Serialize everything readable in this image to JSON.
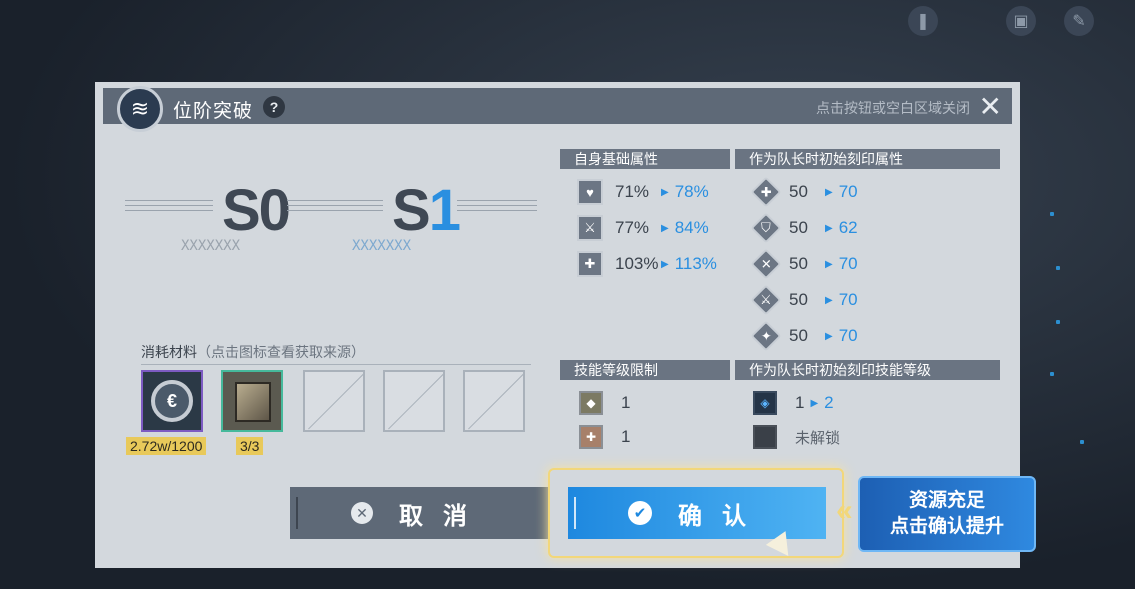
{
  "modal": {
    "title": "位阶突破",
    "help_label": "?",
    "close_hint": "点击按钮或空白区域关闭",
    "close_label": "✕"
  },
  "rank": {
    "from": "S0",
    "to_prefix": "S",
    "to_digit": "1",
    "from_chain": "XXXXXXX",
    "to_chain": "XXXXXXX"
  },
  "materials": {
    "label": "消耗材料",
    "sub_label": "（点击图标查看获取来源）",
    "items": [
      {
        "name": "gear-coin",
        "glyph": "€",
        "count": "2.72w/1200"
      },
      {
        "name": "material-cube",
        "count": "3/3"
      }
    ]
  },
  "base_stats": {
    "title": "自身基础属性",
    "rows": [
      {
        "icon": "heart-icon",
        "glyph": "♥",
        "old": "71%",
        "new": "78%"
      },
      {
        "icon": "sword-icon",
        "glyph": "⚔",
        "old": "77%",
        "new": "84%"
      },
      {
        "icon": "cross-icon",
        "glyph": "✚",
        "old": "103%",
        "new": "113%"
      }
    ]
  },
  "leader_stats": {
    "title": "作为队长时初始刻印属性",
    "rows": [
      {
        "icon": "health-cross-icon",
        "glyph": "✚",
        "old": "50",
        "new": "70"
      },
      {
        "icon": "shield-icon",
        "glyph": "⛉",
        "old": "50",
        "new": "62"
      },
      {
        "icon": "blade-icon",
        "glyph": "✕",
        "old": "50",
        "new": "70"
      },
      {
        "icon": "crossed-swords-icon",
        "glyph": "⚔",
        "old": "50",
        "new": "70"
      },
      {
        "icon": "burst-icon",
        "glyph": "✦",
        "old": "50",
        "new": "70"
      }
    ]
  },
  "skill_limit": {
    "title": "技能等级限制",
    "rows": [
      {
        "icon": "skill-portrait-icon",
        "glyph": "◆",
        "value": "1"
      },
      {
        "icon": "skill-plus-icon",
        "glyph": "✚",
        "value": "1"
      }
    ]
  },
  "leader_skill": {
    "title": "作为队长时初始刻印技能等级",
    "rows": [
      {
        "icon": "imprint-skill-icon",
        "glyph": "◈",
        "old": "1",
        "new": "2"
      },
      {
        "icon": "locked-skill-icon",
        "glyph": "",
        "locked_text": "未解锁"
      }
    ]
  },
  "buttons": {
    "cancel": "取消",
    "confirm": "确认",
    "cancel_glyph": "✕",
    "confirm_glyph": "✔"
  },
  "hint": {
    "line1": "资源充足",
    "line2": "点击确认提升",
    "arrows": "«"
  }
}
